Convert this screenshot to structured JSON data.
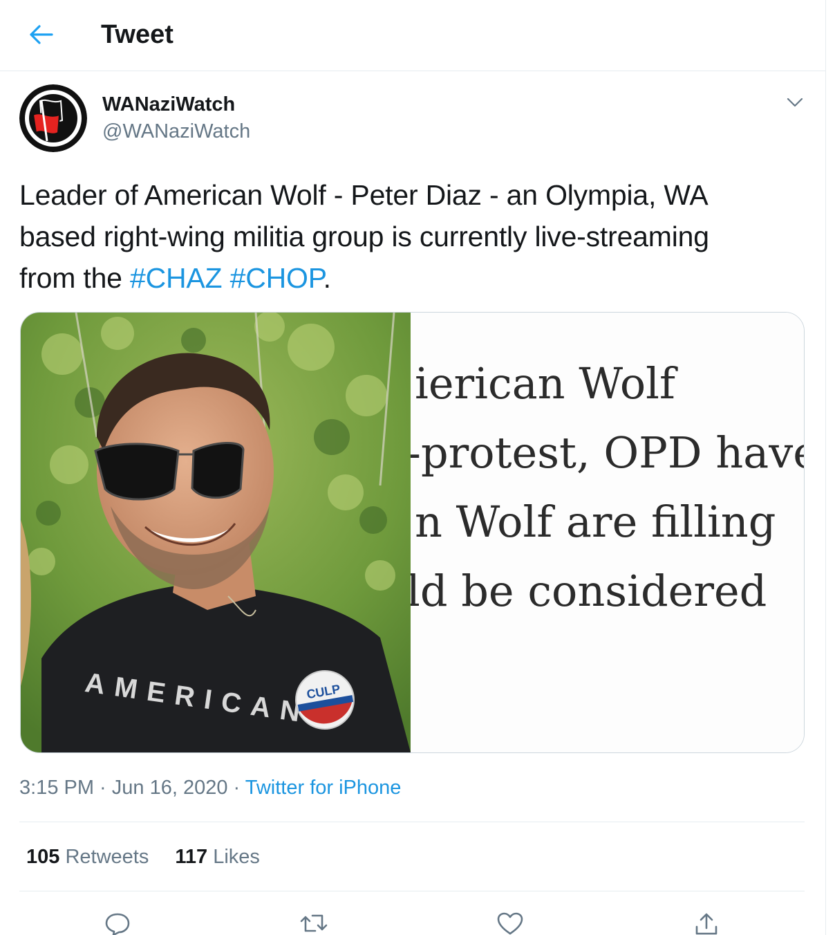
{
  "header": {
    "title": "Tweet",
    "back_icon": "arrow-left-icon"
  },
  "author": {
    "display_name": "WANaziWatch",
    "handle": "@WANaziWatch",
    "avatar_icon": "antifa-flag-logo"
  },
  "tweet": {
    "line1": "Leader of American Wolf - Peter Diaz -  an Olympia, WA",
    "line2": "based right-wing militia group is currently live-streaming",
    "line3_prefix": "from the ",
    "hashtag1": "#CHAZ",
    "hashtag2": "#CHOP",
    "line3_suffix": "."
  },
  "media": {
    "photo_shirt_text": "AMERICAN",
    "photo_button_text": "CULP",
    "article_lines": [
      "ierican Wolf",
      "-protest, OPD have",
      "n Wolf are filling",
      "ld be considered"
    ]
  },
  "meta": {
    "time": "3:15 PM",
    "separator": " · ",
    "date": "Jun 16, 2020",
    "source": "Twitter for iPhone"
  },
  "stats": {
    "retweets_count": "105",
    "retweets_label": "Retweets",
    "likes_count": "117",
    "likes_label": "Likes"
  },
  "actions": {
    "reply_icon": "reply-icon",
    "retweet_icon": "retweet-icon",
    "like_icon": "heart-icon",
    "share_icon": "share-icon"
  },
  "colors": {
    "accent": "#1b95e0",
    "secondary_text": "#657786",
    "border": "#e6ecf0"
  }
}
